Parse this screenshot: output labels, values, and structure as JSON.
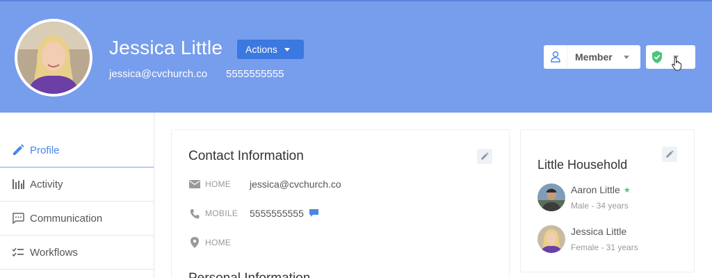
{
  "profile": {
    "name": "Jessica Little",
    "email": "jessica@cvchurch.co",
    "phone": "5555555555",
    "actions_label": "Actions",
    "member_status": "Member"
  },
  "sidebar": {
    "items": [
      {
        "label": "Profile",
        "icon": "pencil-icon",
        "active": true
      },
      {
        "label": "Activity",
        "icon": "activity-bars-icon"
      },
      {
        "label": "Communication",
        "icon": "chat-bubble-icon"
      },
      {
        "label": "Workflows",
        "icon": "checklist-icon"
      }
    ]
  },
  "contact": {
    "title": "Contact Information",
    "rows": [
      {
        "icon": "envelope-icon",
        "label": "HOME",
        "value": "jessica@cvchurch.co"
      },
      {
        "icon": "phone-icon",
        "label": "MOBILE",
        "value": "5555555555"
      },
      {
        "icon": "map-pin-icon",
        "label": "HOME",
        "value": ""
      }
    ],
    "next_section": "Personal Information"
  },
  "household": {
    "title": "Little Household",
    "members": [
      {
        "name": "Aaron Little",
        "details": "Male - 34 years",
        "primary": true
      },
      {
        "name": "Jessica Little",
        "details": "Female - 31 years",
        "primary": false
      }
    ]
  },
  "colors": {
    "header_bg": "#779ded",
    "primary_button": "#3b78e0",
    "active_nav": "#4a86e8",
    "status_green": "#4cc47a"
  }
}
